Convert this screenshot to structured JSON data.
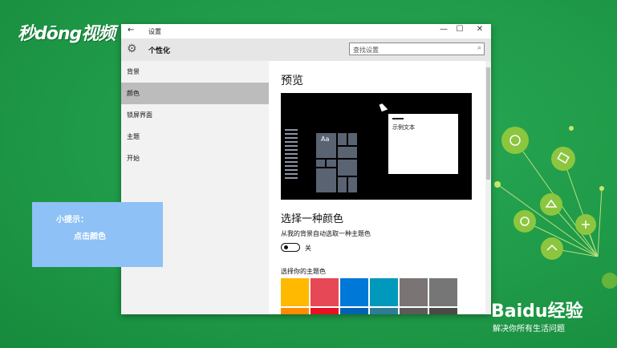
{
  "logo": {
    "text": "秒dōng视频"
  },
  "window": {
    "title": "设置",
    "back_icon": "arrow-left-icon",
    "controls": {
      "minimize": "—",
      "maximize": "☐",
      "close": "✕"
    },
    "page_title": "个性化",
    "search_placeholder": "查找设置"
  },
  "sidebar": {
    "items": [
      {
        "label": "背景",
        "active": false
      },
      {
        "label": "颜色",
        "active": true
      },
      {
        "label": "锁屏界面",
        "active": false
      },
      {
        "label": "主题",
        "active": false
      },
      {
        "label": "开始",
        "active": false
      }
    ]
  },
  "main": {
    "preview_heading": "预览",
    "preview_window_text": "示例文本",
    "preview_tile_text": "Aa",
    "color_heading": "选择一种颜色",
    "auto_label": "从我的背景自动选取一种主题色",
    "toggle_state": "关",
    "theme_label": "选择你的主题色",
    "swatches": [
      "#ffb900",
      "#e74856",
      "#0078d7",
      "#0099bc",
      "#7a7574",
      "#767676"
    ],
    "swatches_row2": [
      "#ff8c00",
      "#e81123",
      "#0063b1",
      "#2d7d9a",
      "#5d5a58",
      "#4c4a48"
    ]
  },
  "tip": {
    "line1": "小提示：",
    "line2": "点击颜色"
  },
  "watermark": {
    "brand_a": "Bai",
    "brand_paw": "du",
    "brand_b": "经验",
    "subtitle": "解决你所有生活问题"
  },
  "colors": {
    "background": "#1f9a48",
    "tip_box": "#8ec1f5",
    "active_nav": "#bcbcbc"
  }
}
